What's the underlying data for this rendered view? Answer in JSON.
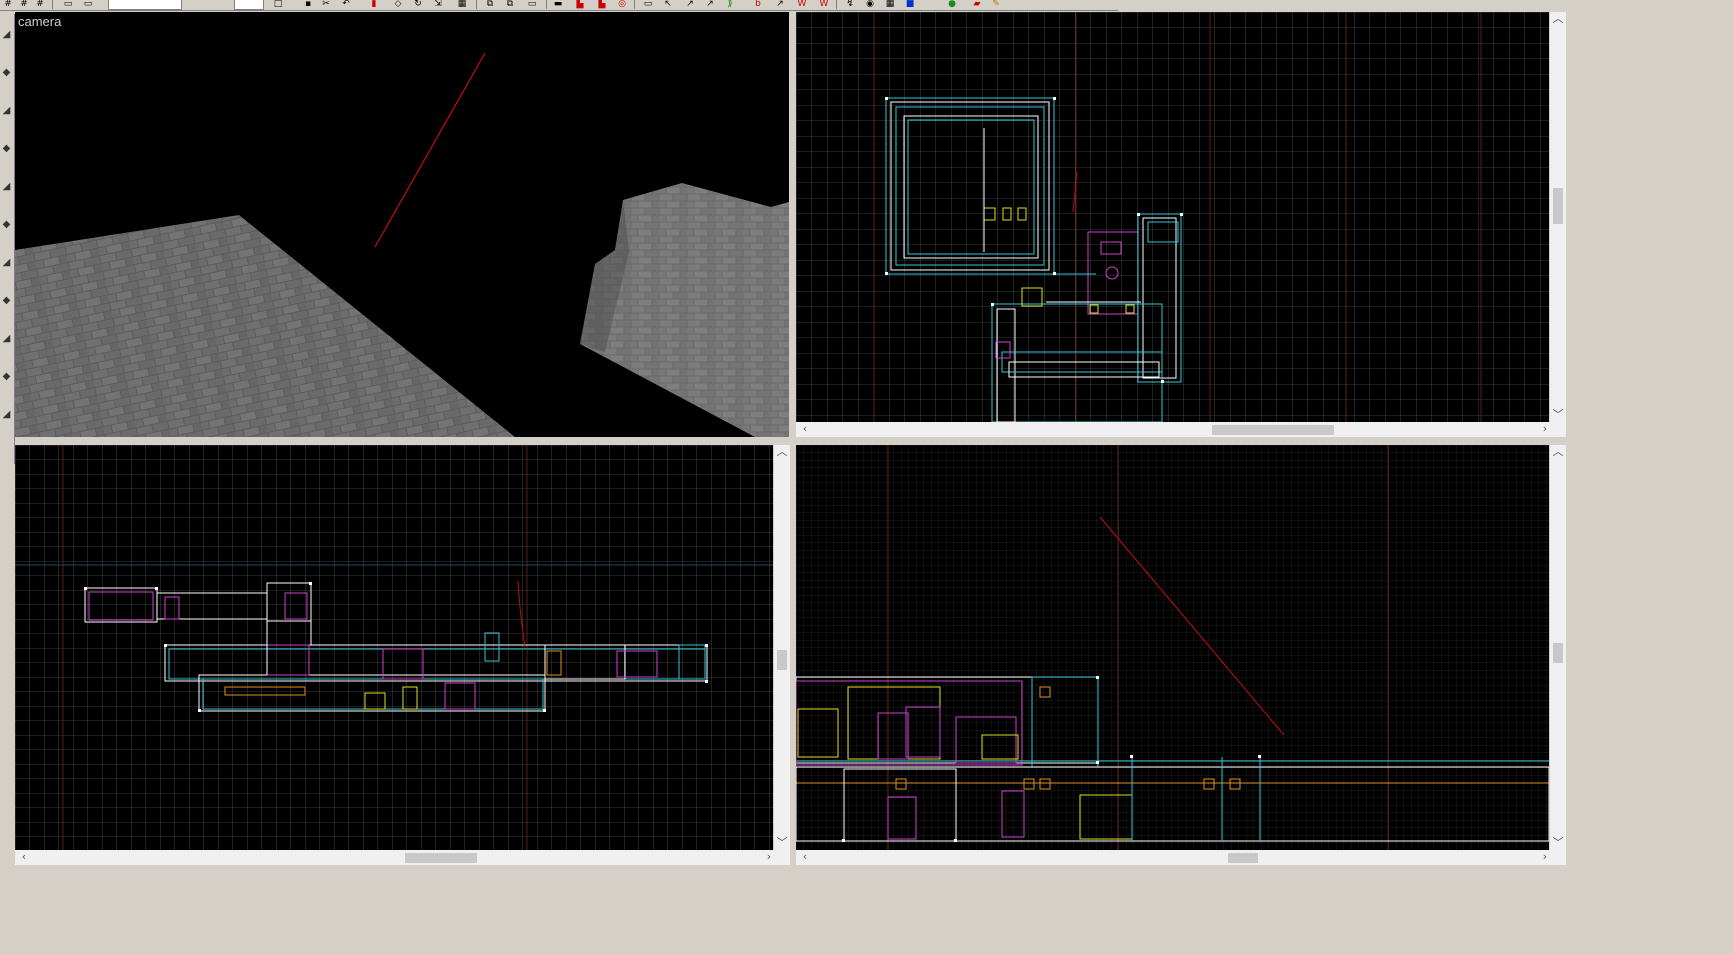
{
  "app": {
    "toolbar_icons": [
      "grid-icon",
      "grid-icon",
      "grid-icon",
      "select-icon",
      "select-icon",
      "new-icon",
      "save-icon",
      "cut-icon",
      "copy-icon",
      "undo-icon",
      "redo-icon",
      "brush-icon",
      "clip-icon",
      "rotate-icon",
      "scale-icon",
      "texture-icon",
      "csg-icon",
      "csg-icon",
      "camera-icon",
      "entity-icon",
      "patch-icon",
      "light-icon",
      "filter-icon",
      "color-icon",
      "help-icon"
    ]
  },
  "viewports": {
    "camera": {
      "label": "camera"
    },
    "top": {
      "label": ""
    },
    "front": {
      "label": ""
    },
    "side": {
      "label": ""
    }
  },
  "colors": {
    "grid_minor": "#3a3a3a",
    "grid_major": "#5a5a5a",
    "axis_line": "#5a2010",
    "brush_white": "#ffffff",
    "brush_cyan": "#33c4d8",
    "brush_magenta": "#d040d0",
    "brush_yellow": "#e0e020",
    "brush_orange": "#e09020",
    "camera_line": "#c01010"
  }
}
